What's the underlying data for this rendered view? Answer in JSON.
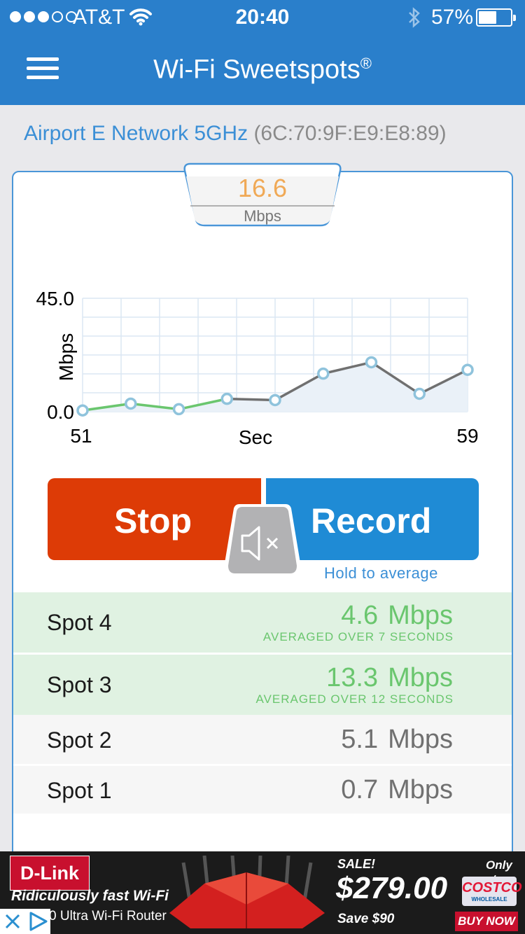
{
  "status_bar": {
    "carrier": "AT&T",
    "time": "20:40",
    "battery": "57%",
    "battery_level": 0.57,
    "signal_bars_filled": 3,
    "signal_bars_total": 5
  },
  "nav": {
    "title": "Wi-Fi Sweetspots",
    "title_mark": "®",
    "menu_icon": "hamburger-menu-icon"
  },
  "network": {
    "name": "Airport E Network 5GHz",
    "mac": "(6C:70:9F:E9:E8:89)"
  },
  "gauge": {
    "value": "16.6",
    "unit": "Mbps"
  },
  "chart_data": {
    "type": "line",
    "ylabel": "Mbps",
    "xlabel": "Sec",
    "ylim": [
      0,
      45
    ],
    "xlim": [
      51,
      59
    ],
    "y_tick_labels": [
      "45.0",
      "0.0"
    ],
    "x_tick_labels": [
      "51",
      "Sec",
      "59"
    ],
    "grid": true,
    "points": [
      {
        "x": 51,
        "y": 0.5,
        "color": "#6ac66e"
      },
      {
        "x": 52,
        "y": 3.2,
        "color": "#6ac66e"
      },
      {
        "x": 53,
        "y": 1.0,
        "color": "#6ac66e"
      },
      {
        "x": 54,
        "y": 5.1,
        "color": "#6ac66e"
      },
      {
        "x": 55,
        "y": 4.6,
        "color": "#707070"
      },
      {
        "x": 56,
        "y": 15.1,
        "color": "#707070"
      },
      {
        "x": 57,
        "y": 19.6,
        "color": "#707070"
      },
      {
        "x": 58,
        "y": 7.1,
        "color": "#707070"
      },
      {
        "x": 59,
        "y": 16.6,
        "color": "#707070"
      }
    ]
  },
  "controls": {
    "stop_label": "Stop",
    "record_label": "Record",
    "record_hint": "Hold to average",
    "mute_icon": "speaker-muted-icon"
  },
  "spots": [
    {
      "name": "Spot 4",
      "value": "4.6",
      "unit": "Mbps",
      "sub": "AVERAGED OVER 7 SECONDS",
      "style": "green"
    },
    {
      "name": "Spot 3",
      "value": "13.3",
      "unit": "Mbps",
      "sub": "AVERAGED OVER 12 SECONDS",
      "style": "green"
    },
    {
      "name": "Spot 2",
      "value": "5.1",
      "unit": "Mbps",
      "sub": "",
      "style": "grey"
    },
    {
      "name": "Spot 1",
      "value": "0.7",
      "unit": "Mbps",
      "sub": "",
      "style": "grey"
    }
  ],
  "ad": {
    "brand": "D-Link",
    "tagline": "Ridiculously fast Wi-Fi",
    "product": "0 Ultra Wi-Fi Router",
    "sale": "SALE!",
    "price": "$279.00",
    "save": "Save $90",
    "only_at": "Only at",
    "retailer": "COSTCO",
    "retailer_sub": "WHOLESALE",
    "cta": "BUY NOW"
  },
  "colors": {
    "nav_blue": "#2a7fcb",
    "stop_red": "#dd3b06",
    "record_blue": "#1f8bd5",
    "gauge_orange": "#f0a956",
    "spot_green": "#6ac66e"
  }
}
